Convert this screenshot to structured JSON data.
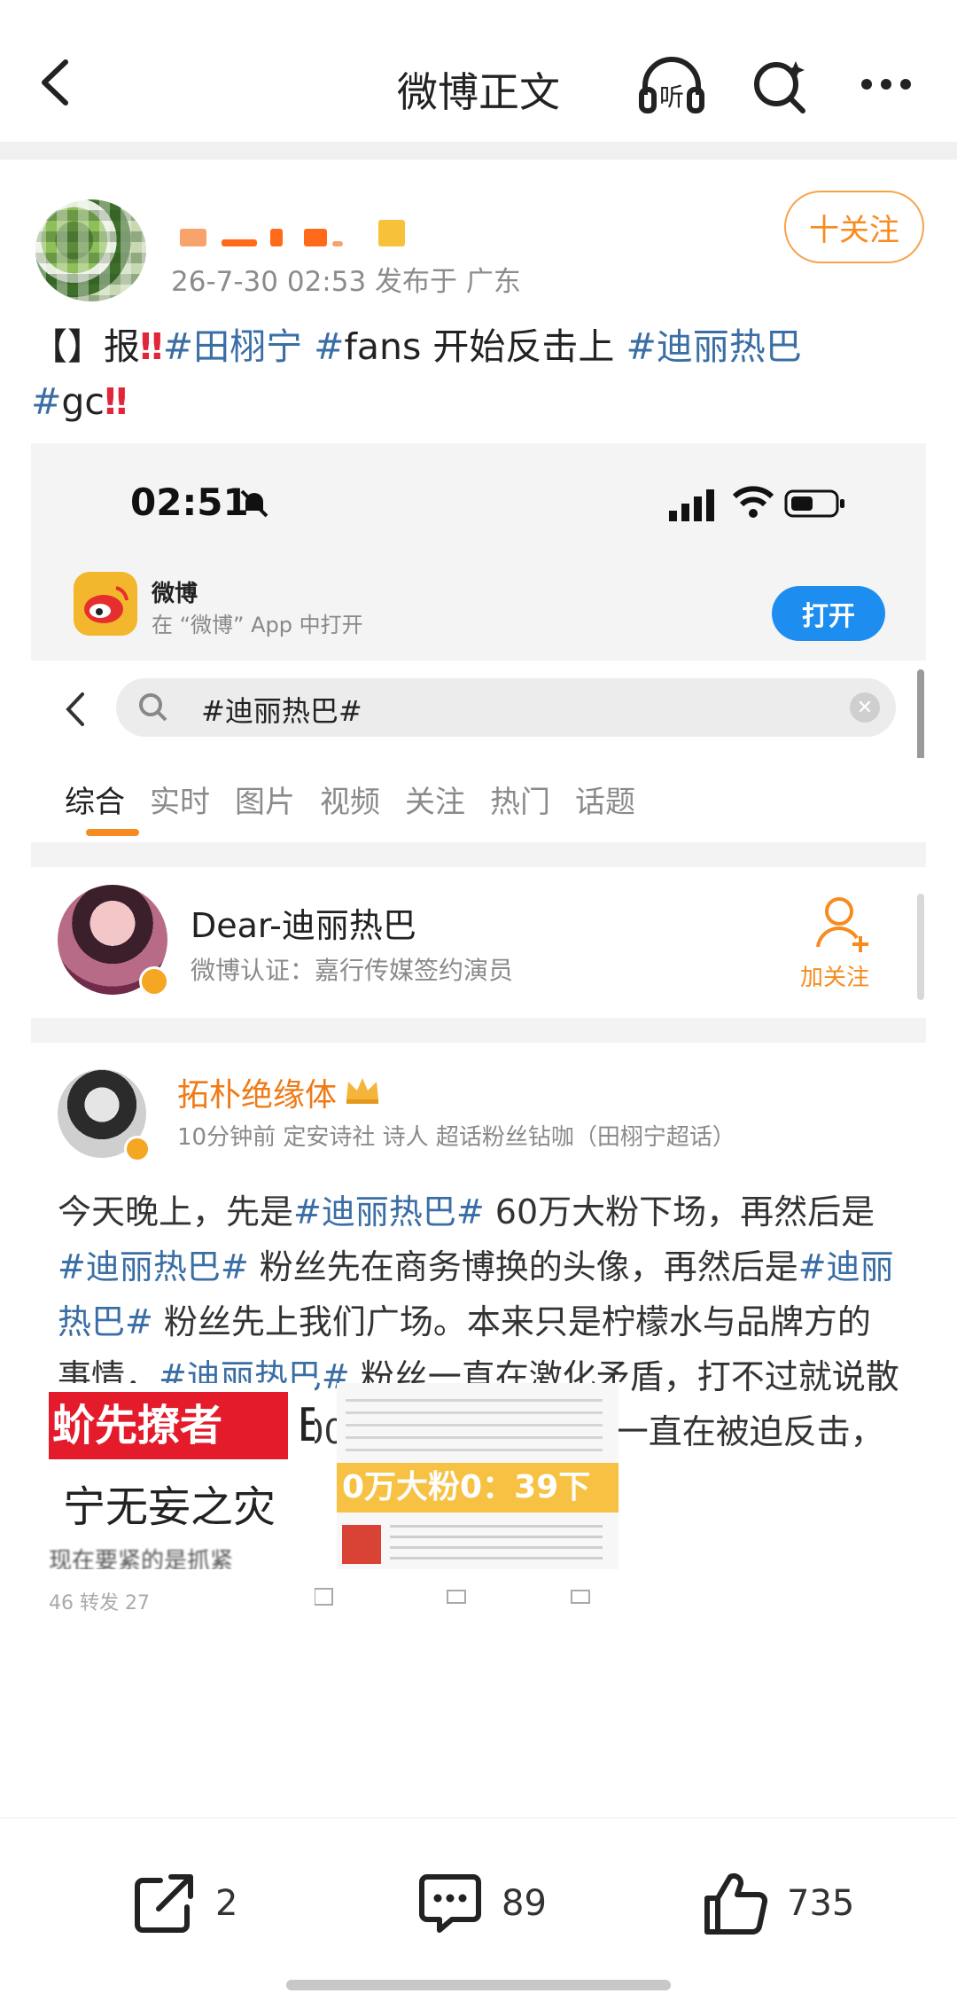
{
  "nav": {
    "title": "微博正文",
    "listen_label": "听"
  },
  "post": {
    "meta": "26-7-30 02:53  发布于 广东",
    "follow_label": "十关注",
    "text": {
      "p1": "【】报",
      "tag1": "#田栩宁",
      "p2": " ",
      "tag2": "#",
      "p3": "fans 开始反击上 ",
      "tag3": "#迪丽热巴",
      "tag4": "#",
      "p4": "gc"
    }
  },
  "screenshot": {
    "clock": "02:51",
    "app_name": "微博",
    "app_sub": "在 “微博” App 中打开",
    "open_label": "打开",
    "search_query": "#迪丽热巴#",
    "tabs": [
      "综合",
      "实时",
      "图片",
      "视频",
      "关注",
      "热门",
      "话题"
    ],
    "user_card": {
      "name": "Dear-迪丽热巴",
      "verify": "微博认证：嘉行传媒签约演员",
      "follow_label": "加关注"
    },
    "feed": {
      "name": "拓朴绝缘体",
      "meta": "10分钟前  定安诗社 诗人 超话粉丝钻咖（田栩宁超话）",
      "t1": "今天晚上，先是",
      "tag1": "#迪丽热巴#",
      "t2": " 60万大粉下场，再然后是",
      "tag2": "#迪丽热巴#",
      "t3": " 粉丝先在商务博换的头像，再然后是",
      "tag3": "#迪丽热巴#",
      "t4": " 粉丝先上我们广场。本来只是柠檬水与品牌方的事情，",
      "tag4": "#迪丽热巴#",
      "t5": " 粉丝一直在激化矛盾，打不过就说散粉是数据组，1400转是买水，柠檬水一直在被迫反击，望周知。"
    },
    "img_left": {
      "line1": "蚧先撩者",
      "line2": "宁无妄之灾",
      "line3": "现在要紧的是抓紧",
      "edge": "E"
    },
    "img_right": {
      "banner": "0万大粉0：39下"
    },
    "footer_left": "46   转发 27"
  },
  "actions": {
    "share_count": "2",
    "comment_count": "89",
    "like_count": "735"
  },
  "colors": {
    "tag_blue": "#3a6ea5",
    "accent_orange": "#f78b1f",
    "alert_red": "#e0263a",
    "open_blue": "#1d8ef0"
  }
}
